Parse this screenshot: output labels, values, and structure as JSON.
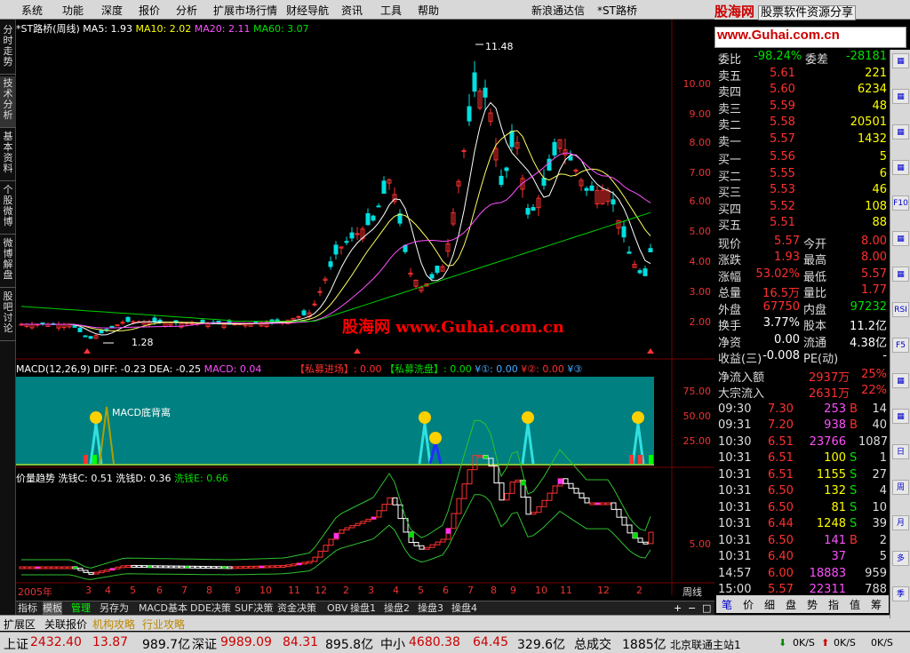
{
  "menu": {
    "items": [
      "系统",
      "功能",
      "深度",
      "报价",
      "分析",
      "扩展市场行情",
      "财经导航",
      "资讯",
      "工具",
      "帮助"
    ],
    "center_left": "新浪通达信",
    "center_right": "*ST路桥"
  },
  "brand": {
    "name": "股海网",
    "tagline": "股票软件资源分享",
    "url": "www.Guhai.com.cn"
  },
  "left_tabs": [
    "分时走势",
    "技术分析",
    "基本资料",
    "个股微博",
    "微博解盘",
    "股吧讨论"
  ],
  "main_legend": {
    "title": "*ST路桥(周线)",
    "ma5": "MA5: 1.93",
    "ma10": "MA10: 2.02",
    "ma20": "MA20: 2.11",
    "ma60": "MA60: 3.07"
  },
  "main_axis": [
    "10.00",
    "9.00",
    "8.00",
    "7.00",
    "6.00",
    "5.00",
    "4.00",
    "3.00",
    "2.00"
  ],
  "annotations": {
    "high": "11.48",
    "low": "1.28",
    "watermark": "股海网  www.Guhai.com.cn"
  },
  "macd_legend": {
    "title": "MACD(12,26,9)",
    "diff": "DIFF: -0.23",
    "dea": "DEA: -0.25",
    "macd": "MACD: 0.04",
    "p1": "【私募进场】: 0.00",
    "p2": "【私募洗盘】: 0.00",
    "p3": "¥①: 0.00",
    "p4": "¥②: 0.00",
    "p5": "¥③"
  },
  "macd_axis": [
    "75.00",
    "50.00",
    "25.00"
  ],
  "macd_note": "MACD底背离",
  "trend_legend": {
    "title": "价量趋势",
    "c": "洗钱C: 0.51",
    "d": "洗钱D: 0.36",
    "e": "洗钱E: 0.66"
  },
  "trend_axis": [
    "5.00"
  ],
  "xaxis": {
    "labels": [
      "2005年",
      "3",
      "4",
      "5",
      "6",
      "7",
      "8",
      "9",
      "10",
      "11",
      "12",
      "2",
      "3",
      "4",
      "5",
      "6",
      "7",
      "8",
      "9",
      "10",
      "11",
      "12",
      "2"
    ],
    "period": "周线"
  },
  "bottom_tabs": [
    "指标",
    "模板",
    "管理",
    "另存为",
    "MACD基本",
    "DDE决策",
    "SUF决策",
    "资金决策",
    "OBV",
    "操盘1",
    "操盘2",
    "操盘3",
    "操盘4"
  ],
  "ext_tabs": [
    "扩展区",
    "关联报价",
    "机构攻略",
    "行业攻略"
  ],
  "quote": {
    "webi": {
      "l": "委比",
      "v": "-98.24%",
      "l2": "委差",
      "v2": "-28181"
    },
    "asks": [
      {
        "l": "卖五",
        "p": "5.61",
        "v": "221"
      },
      {
        "l": "卖四",
        "p": "5.60",
        "v": "6234"
      },
      {
        "l": "卖三",
        "p": "5.59",
        "v": "48"
      },
      {
        "l": "卖二",
        "p": "5.58",
        "v": "20501"
      },
      {
        "l": "卖一",
        "p": "5.57",
        "v": "1432"
      }
    ],
    "bids": [
      {
        "l": "买一",
        "p": "5.56",
        "v": "5"
      },
      {
        "l": "买二",
        "p": "5.55",
        "v": "6"
      },
      {
        "l": "买三",
        "p": "5.53",
        "v": "46"
      },
      {
        "l": "买四",
        "p": "5.52",
        "v": "108"
      },
      {
        "l": "买五",
        "p": "5.51",
        "v": "88"
      }
    ],
    "stats": [
      [
        "现价",
        "5.57",
        "今开",
        "8.00"
      ],
      [
        "涨跌",
        "1.93",
        "最高",
        "8.00"
      ],
      [
        "涨幅",
        "53.02%",
        "最低",
        "5.57"
      ],
      [
        "总量",
        "16.5万",
        "量比",
        "1.77"
      ],
      [
        "外盘",
        "67750",
        "内盘",
        "97232"
      ],
      [
        "换手",
        "3.77%",
        "股本",
        "11.2亿"
      ],
      [
        "净资",
        "0.00",
        "流通",
        "4.38亿"
      ],
      [
        "收益(三)",
        "-0.008",
        "PE(动)",
        "-"
      ]
    ],
    "flow": [
      [
        "净流入额",
        "2937万",
        "25%"
      ],
      [
        "大宗流入",
        "2631万",
        "22%"
      ]
    ],
    "ticks": [
      [
        "09:30",
        "7.30",
        "253",
        "B",
        "14"
      ],
      [
        "09:31",
        "7.20",
        "938",
        "B",
        "40"
      ],
      [
        "10:30",
        "6.51",
        "23766",
        "",
        "1087"
      ],
      [
        "10:31",
        "6.51",
        "100",
        "S",
        "1"
      ],
      [
        "10:31",
        "6.51",
        "1155",
        "S",
        "27"
      ],
      [
        "10:31",
        "6.50",
        "132",
        "S",
        "4"
      ],
      [
        "10:31",
        "6.50",
        "81",
        "S",
        "10"
      ],
      [
        "10:31",
        "6.44",
        "1248",
        "S",
        "39"
      ],
      [
        "10:31",
        "6.50",
        "141",
        "B",
        "2"
      ],
      [
        "10:31",
        "6.40",
        "37",
        "",
        "5"
      ],
      [
        "14:57",
        "6.00",
        "18883",
        "",
        "959"
      ],
      [
        "15:00",
        "5.57",
        "22311",
        "",
        "788"
      ]
    ],
    "tabs": [
      "笔",
      "价",
      "细",
      "盘",
      "势",
      "指",
      "值",
      "筹"
    ]
  },
  "right_icons": [
    "F10",
    "RSI",
    "F5",
    "日",
    "周",
    "月",
    "多",
    "季"
  ],
  "status": {
    "sh_l": "上证",
    "sh_v": "2432.40",
    "sh_c": "13.87",
    "sh_a": "989.7亿",
    "sz_l": "深证",
    "sz_v": "9989.09",
    "sz_c": "84.31",
    "sz_a": "895.8亿",
    "zx_l": "中小",
    "zx_v": "4680.38",
    "zx_c": "64.45",
    "zx_a": "329.6亿",
    "tot_l": "总成交",
    "tot_v": "1885亿",
    "server": "北京联通主站1",
    "net1": "0K/S",
    "net2": "0K/S",
    "net3": "0K/S"
  },
  "colors": {
    "up": "#ff3030",
    "down": "#00e0e0",
    "bg": "#000000",
    "macd_bg": "#008080"
  }
}
